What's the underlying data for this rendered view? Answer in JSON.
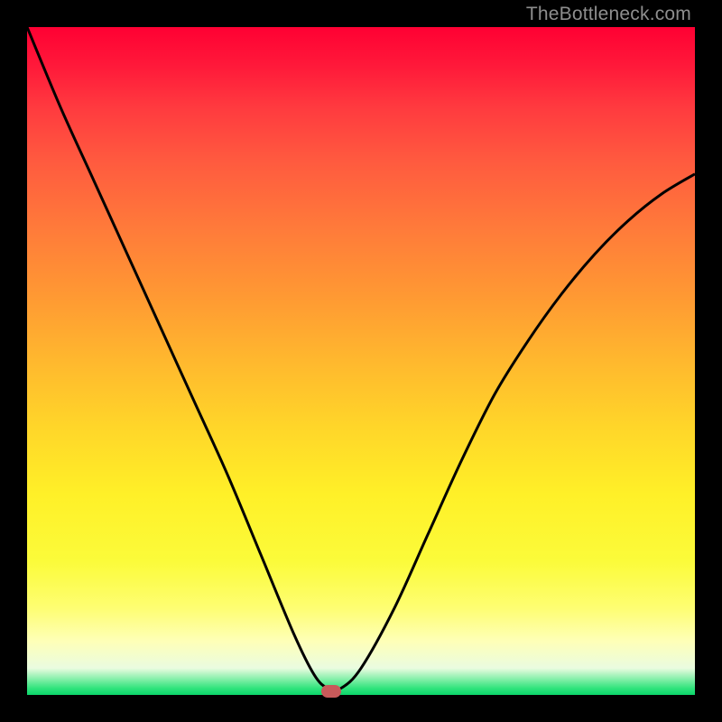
{
  "watermark": "TheBottleneck.com",
  "colors": {
    "frame": "#000000",
    "curve": "#000000",
    "marker": "#c85a5a",
    "gradient_top": "#ff0033",
    "gradient_bottom": "#0cd66b"
  },
  "chart_data": {
    "type": "line",
    "title": "",
    "xlabel": "",
    "ylabel": "",
    "xlim": [
      0,
      1
    ],
    "ylim": [
      0,
      1
    ],
    "series": [
      {
        "name": "bottleneck-curve",
        "x": [
          0.0,
          0.05,
          0.1,
          0.15,
          0.2,
          0.25,
          0.3,
          0.35,
          0.4,
          0.43,
          0.45,
          0.47,
          0.5,
          0.55,
          0.6,
          0.65,
          0.7,
          0.75,
          0.8,
          0.85,
          0.9,
          0.95,
          1.0
        ],
        "y": [
          1.0,
          0.88,
          0.77,
          0.66,
          0.55,
          0.44,
          0.33,
          0.21,
          0.09,
          0.03,
          0.01,
          0.01,
          0.04,
          0.13,
          0.24,
          0.35,
          0.45,
          0.53,
          0.6,
          0.66,
          0.71,
          0.75,
          0.78
        ]
      }
    ],
    "annotations": [
      {
        "name": "optimum-marker",
        "x": 0.455,
        "y": 0.005
      }
    ]
  }
}
